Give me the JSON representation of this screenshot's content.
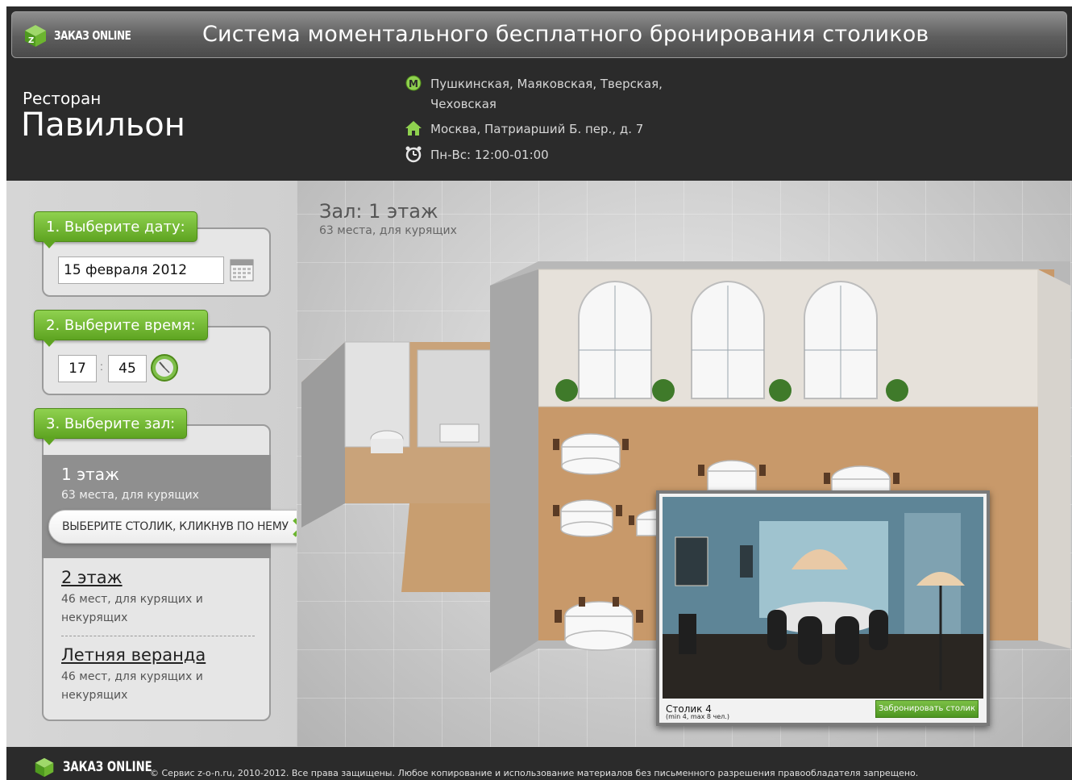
{
  "header": {
    "logo_text": "ЗАКАЗ ONLINE",
    "title": "Система моментального бесплатного бронирования столиков"
  },
  "restaurant": {
    "type": "Ресторан",
    "name": "Павильон",
    "metro": "Пушкинская, Маяковская, Тверская, Чеховская",
    "address": "Москва, Патриарший Б. пер., д. 7",
    "hours": "Пн-Вс: 12:00-01:00"
  },
  "steps": {
    "date_label": "1. Выберите дату:",
    "date_value": "15 февраля 2012",
    "time_label": "2. Выберите время:",
    "hour_value": "17",
    "time_separator": ":",
    "minute_value": "45",
    "hall_label": "3. Выберите зал:"
  },
  "halls": [
    {
      "name": "1 этаж",
      "desc": "63 места, для курящих",
      "active": true
    },
    {
      "name": "2 этаж",
      "desc": "46 мест, для курящих и некурящих",
      "active": false
    },
    {
      "name": "Летняя веранда",
      "desc": "46 мест, для курящих и некурящих",
      "active": false
    }
  ],
  "hint": "ВЫБЕРИТЕ СТОЛИК, КЛИКНУВ ПО НЕМУ",
  "main": {
    "zal_title": "Зал: 1 этаж",
    "zal_sub": "63 места, для курящих"
  },
  "popup": {
    "title": "Столик 4",
    "sub": "(min 4, max 8 чел.)",
    "book_button": "Забронировать столик"
  },
  "footer": {
    "logo_text": "ЗАКАЗ ONLINE",
    "copyright": "© Сервис z-o-n.ru, 2010-2012. Все права защищены. Любое копирование и использование материалов без письменного разрешения правообладателя запрещено."
  },
  "colors": {
    "accent_green": "#6cb52f",
    "dark_bg": "#2b2b2b",
    "panel_bg": "#d3d3d3"
  }
}
